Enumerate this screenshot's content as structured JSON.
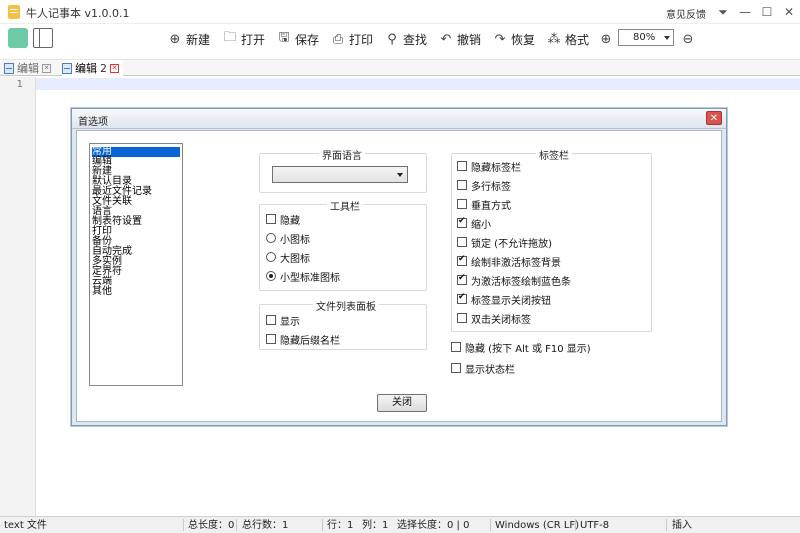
{
  "app": {
    "title": "牛人记事本 v1.0.0.1",
    "feedback": "意见反馈"
  },
  "toolbar": {
    "new_label": "新建",
    "open_label": "打开",
    "save_label": "保存",
    "print_label": "打印",
    "find_label": "查找",
    "undo_label": "撤销",
    "redo_label": "恢复",
    "format_label": "格式",
    "zoom_value": "80%"
  },
  "tabs": [
    {
      "label": "编辑",
      "active": false
    },
    {
      "label": "编辑",
      "number": "2",
      "active": true
    }
  ],
  "editor": {
    "line_number": "1"
  },
  "dialog": {
    "title": "首选项",
    "categories": [
      "常用",
      "编辑",
      "新建",
      "默认目录",
      "最近文件记录",
      "文件关联",
      "语言",
      "制表符设置",
      "打印",
      "备份",
      "自动完成",
      "多实例",
      "定界符",
      "云端",
      "其他"
    ],
    "language_group": {
      "title": "界面语言",
      "select_value": ""
    },
    "toolbar_group": {
      "title": "工具栏",
      "hide_label": "隐藏",
      "small_icon": "小图标",
      "large_icon": "大图标",
      "small_standard_icon": "小型标准图标"
    },
    "filelist_group": {
      "title": "文件列表面板",
      "show_label": "显示",
      "hide_ext_label": "隐藏后缀名栏"
    },
    "tabbar_group": {
      "title": "标签栏",
      "options": [
        {
          "label": "隐藏标签栏",
          "checked": false
        },
        {
          "label": "多行标签",
          "checked": false
        },
        {
          "label": "垂直方式",
          "checked": false
        },
        {
          "label": "缩小",
          "checked": true
        },
        {
          "label": "锁定 (不允许拖放)",
          "checked": false
        },
        {
          "label": "绘制非激活标签背景",
          "checked": true
        },
        {
          "label": "为激活标签绘制蓝色条",
          "checked": true
        },
        {
          "label": "标签显示关闭按钮",
          "checked": true
        },
        {
          "label": "双击关闭标签",
          "checked": false
        }
      ]
    },
    "hide_menu_label": "隐藏 (按下 Alt 或 F10 显示)",
    "show_statusbar_label": "显示状态栏",
    "close_button": "关闭"
  },
  "statusbar": {
    "file_type": "text 文件",
    "total_length": "总长度：0",
    "total_lines": "总行数：1",
    "line": "行：1",
    "column": "列：1",
    "selection": "选择长度：0 | 0",
    "eol": "Windows (CR LF)",
    "encoding": "UTF-8",
    "mode": "插入"
  }
}
